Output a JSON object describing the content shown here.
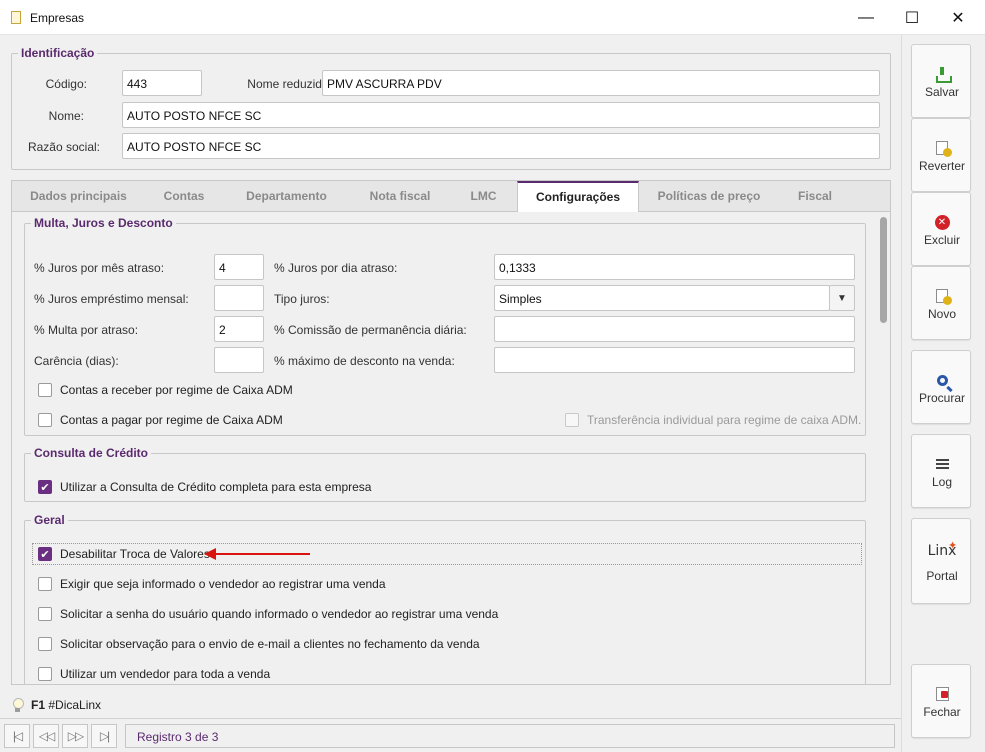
{
  "window": {
    "title": "Empresas",
    "minimize": "—",
    "maximize": "☐",
    "close": "✕"
  },
  "identificacao": {
    "legend": "Identificação",
    "codigo_label": "Código:",
    "codigo_value": "443",
    "nome_reduzido_label": "Nome reduzido:",
    "nome_reduzido_value": "PMV ASCURRA PDV",
    "nome_label": "Nome:",
    "nome_value": "AUTO POSTO NFCE SC",
    "razao_label": "Razão social:",
    "razao_value": "AUTO POSTO NFCE SC"
  },
  "tabs": [
    {
      "label": "Dados principais"
    },
    {
      "label": "Contas"
    },
    {
      "label": "Departamento"
    },
    {
      "label": "Nota fiscal"
    },
    {
      "label": "LMC"
    },
    {
      "label": "Configurações"
    },
    {
      "label": "Políticas de preço"
    },
    {
      "label": "Fiscal"
    }
  ],
  "multa": {
    "legend": "Multa, Juros e Desconto",
    "juros_mes_label": "% Juros por mês atraso:",
    "juros_mes_value": "4",
    "juros_dia_label": "% Juros por dia atraso:",
    "juros_dia_value": "0,1333",
    "juros_emp_label": "% Juros empréstimo mensal:",
    "juros_emp_value": "",
    "tipo_juros_label": "Tipo juros:",
    "tipo_juros_value": "Simples",
    "multa_label": "% Multa por atraso:",
    "multa_value": "2",
    "comissao_label": "% Comissão de permanência diária:",
    "comissao_value": "",
    "carencia_label": "Carência (dias):",
    "carencia_value": "",
    "desconto_label": "% máximo de desconto na venda:",
    "desconto_value": "",
    "chk_receber": "Contas a receber por regime de Caixa ADM",
    "chk_pagar": "Contas a pagar por regime de Caixa ADM",
    "chk_transferencia": "Transferência individual para regime de caixa ADM."
  },
  "consulta": {
    "legend": "Consulta de Crédito",
    "chk_consulta": "Utilizar a Consulta de Crédito completa para esta empresa"
  },
  "geral": {
    "legend": "Geral",
    "items": [
      {
        "label": "Desabilitar Troca de Valores",
        "checked": true
      },
      {
        "label": "Exigir que seja informado o vendedor ao registrar uma venda",
        "checked": false
      },
      {
        "label": "Solicitar a senha do usuário quando informado o vendedor ao registrar uma venda",
        "checked": false
      },
      {
        "label": "Solicitar observação para o envio de e-mail a clientes no fechamento da venda",
        "checked": false
      },
      {
        "label": "Utilizar um vendedor para toda a venda",
        "checked": false
      }
    ]
  },
  "hint": {
    "key": "F1",
    "text": "#DicaLinx"
  },
  "navigation": {
    "first": "|◁",
    "prev": "◁◁",
    "next": "▷▷",
    "last": "▷|",
    "record": "Registro 3 de 3"
  },
  "sidebar": {
    "salvar": "Salvar",
    "reverter": "Reverter",
    "excluir": "Excluir",
    "novo": "Novo",
    "procurar": "Procurar",
    "log": "Log",
    "linx": "Linx",
    "portal": "Portal",
    "fechar": "Fechar"
  },
  "colors": {
    "accent": "#5a2a6e",
    "check": "#6b2f82",
    "arrow": "#d9140f"
  }
}
